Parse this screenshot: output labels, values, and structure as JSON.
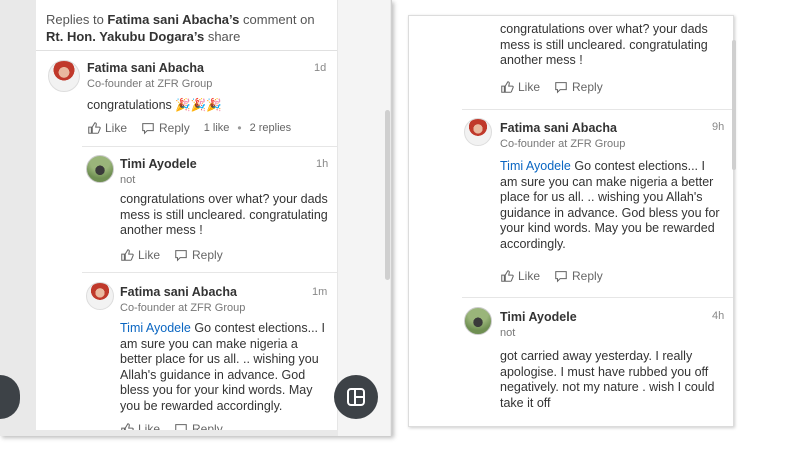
{
  "left_panel": {
    "header": {
      "prefix": "Replies to ",
      "author": "Fatima sani Abacha’s",
      "middle": " comment on ",
      "target": "Rt. Hon. Yakubu Dogara’s",
      "suffix": " share"
    },
    "comments": [
      {
        "name": "Fatima sani Abacha",
        "headline": "Co-founder  at ZFR Group",
        "time": "1d",
        "text": "congratulations 🎉🎉🎉",
        "like": "Like",
        "reply": "Reply",
        "likes_count": "1 like",
        "replies_count": "2 replies"
      },
      {
        "name": "Timi Ayodele",
        "headline": "not",
        "time": "1h",
        "text": "congratulations over what?  your dads mess is still uncleared. congratulating another mess !",
        "like": "Like",
        "reply": "Reply"
      },
      {
        "name": "Fatima sani Abacha",
        "headline": "Co-founder  at ZFR Group",
        "time": "1m",
        "mention": "Timi Ayodele",
        "text": " Go contest elections... I am sure you can make nigeria a better place for us all. .. wishing you Allah's guidance in advance.  God bless you for your kind words. May you be rewarded accordingly.",
        "like": "Like",
        "reply": "Reply"
      }
    ]
  },
  "right_panel": {
    "top_text": "congratulations over what?  your dads mess is still uncleared. congratulating another mess !",
    "top_like": "Like",
    "top_reply": "Reply",
    "comments": [
      {
        "name": "Fatima sani Abacha",
        "headline": "Co-founder  at ZFR Group",
        "time": "9h",
        "mention": "Timi Ayodele",
        "text": " Go contest elections... I am sure you can make nigeria a better place for us all. .. wishing you Allah's guidance in advance.  God bless you for your kind words. May you be rewarded accordingly.",
        "like": "Like",
        "reply": "Reply"
      },
      {
        "name": "Timi Ayodele",
        "headline": "not",
        "time": "4h",
        "text": "got carried away yesterday. I really apologise. I must have rubbed you off negatively. not my nature . wish I could take it off"
      }
    ]
  },
  "colors": {
    "mention": "#0a66c2",
    "fab": "#3d4247"
  },
  "icons": [
    "like-icon",
    "reply-icon",
    "compose-icon"
  ]
}
